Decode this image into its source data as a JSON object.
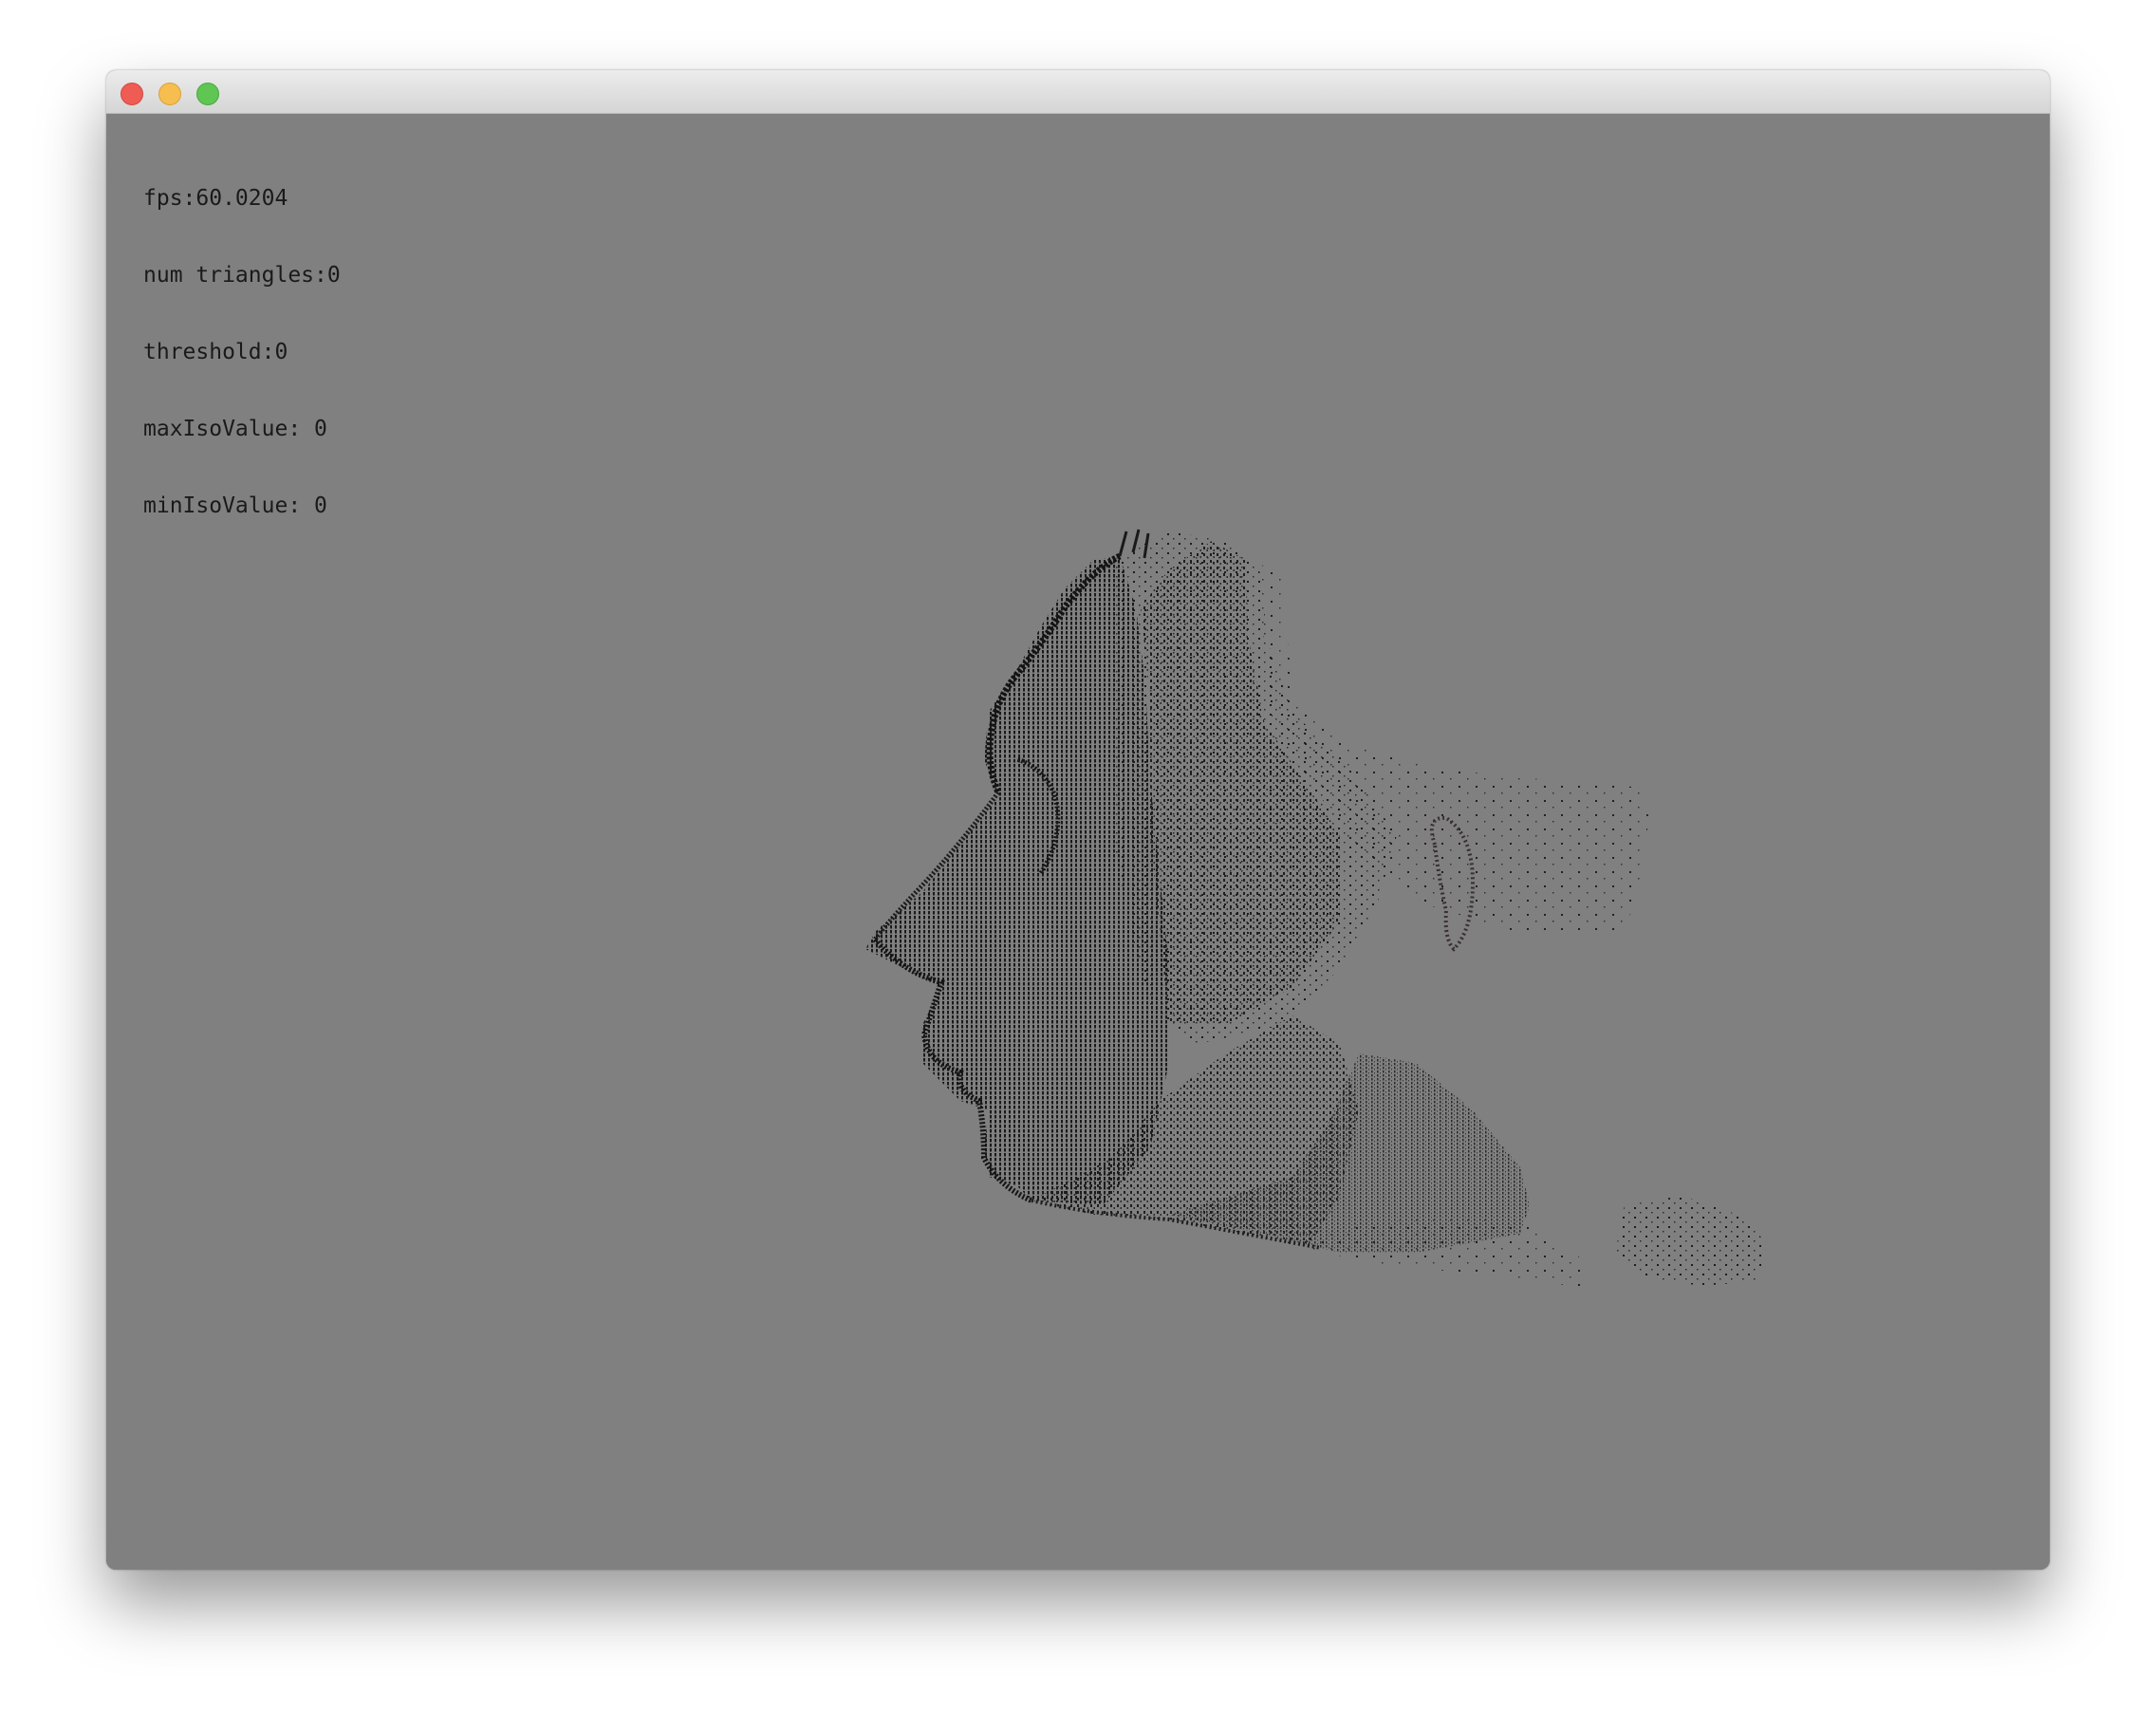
{
  "window": {
    "title": "",
    "background_color": "#808080",
    "traffic_lights": [
      "close",
      "minimize",
      "maximize"
    ]
  },
  "hud": {
    "fps": "fps:60.0204",
    "num_triangles": "num triangles:0",
    "threshold": "threshold:0",
    "max_iso": "maxIsoValue: 0",
    "min_iso": "minIsoValue: 0"
  },
  "scene": {
    "content": "point-cloud-head-profile",
    "point_color": "#1c1c1c"
  }
}
